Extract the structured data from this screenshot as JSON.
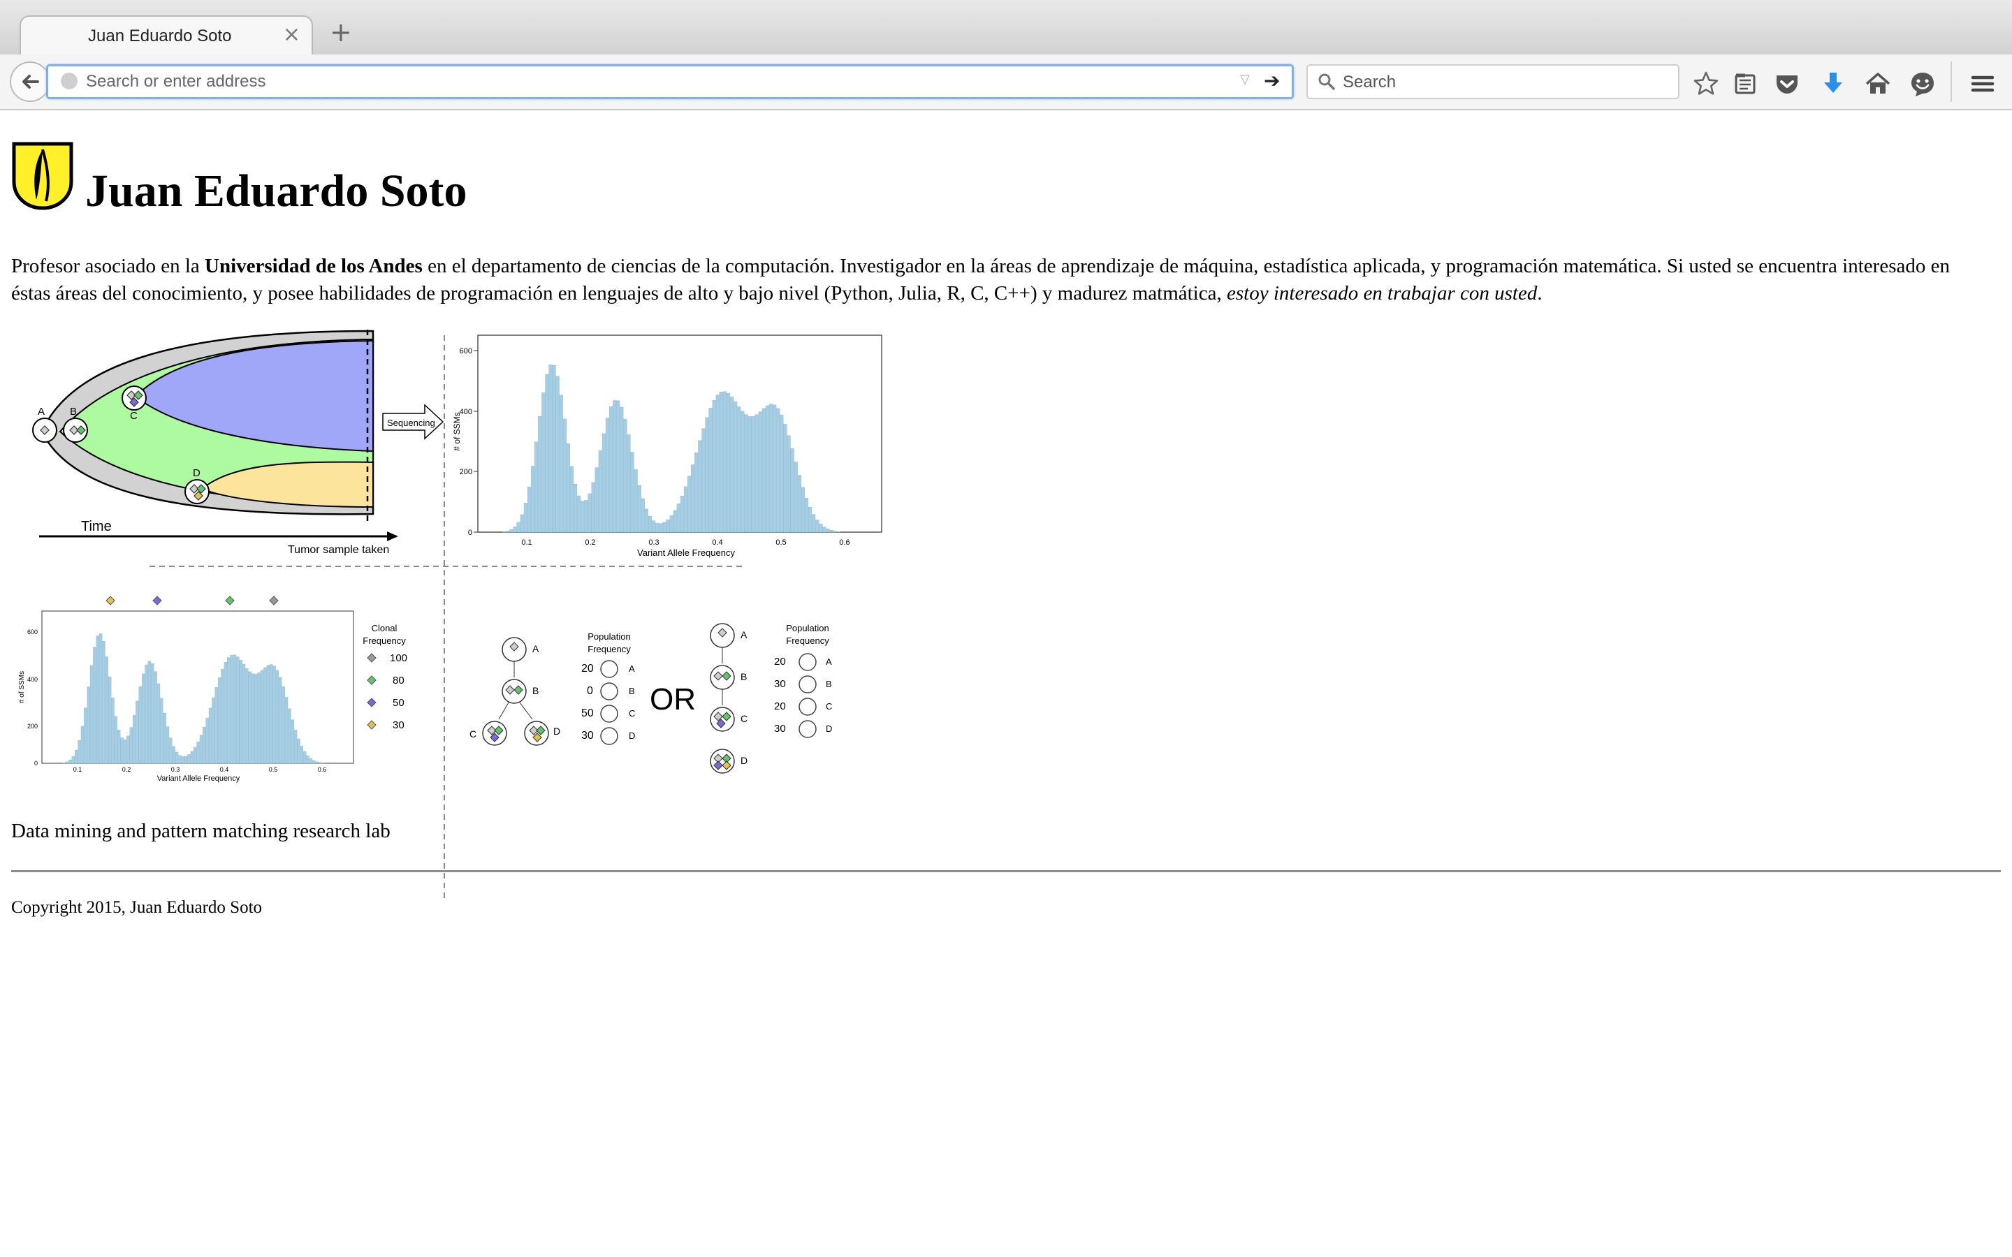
{
  "browser": {
    "tab_title": "Juan Eduardo Soto",
    "tab_close_glyph": "×",
    "new_tab_glyph": "+",
    "address_placeholder": "Search or enter address",
    "address_value": "",
    "search_placeholder": "Search",
    "toolbar_icons": [
      "bookmark-star-icon",
      "reading-list-icon",
      "pocket-icon",
      "downloads-icon",
      "home-icon",
      "hello-icon",
      "menu-icon"
    ],
    "accent_color": "#2a91ea"
  },
  "page": {
    "title": "Juan Eduardo Soto",
    "intro": {
      "part1": "Profesor asociado en la ",
      "university": "Universidad de los Andes",
      "part2": " en el departamento de ciencias de la computación. Investigador en la áreas de aprendizaje de máquina, estadística aplicada, y programación matemática. Si usted se encuentra interesado en éstas áreas del conocimiento, y posee habilidades de programación en lenguajes de alto y bajo nivel (Python, Julia, R, C, C++) y madurez matmática, ",
      "emphasis": "estoy interesado en trabajar con usted",
      "end": "."
    },
    "lab": "Data mining and pattern matching research lab",
    "copyright": "Copyright 2015, Juan Eduardo Soto"
  },
  "figure": {
    "evolution": {
      "clone_labels": [
        "A",
        "B",
        "C",
        "D"
      ],
      "time_label": "Time",
      "sample_label": "Tumor sample taken",
      "arrow_label": "Sequencing",
      "colors": {
        "A": "#cfcfcf",
        "B": "#aefaa0",
        "C": "#a0a6f8",
        "D": "#fde49c"
      }
    },
    "histogram_top": {
      "ylabel": "# of SSMs",
      "xlabel": "Variant Allele Frequency",
      "y_ticks": [
        "600",
        "400",
        "200",
        "0"
      ],
      "x_ticks": [
        "0.1",
        "0.2",
        "0.3",
        "0.4",
        "0.5",
        "0.6"
      ]
    },
    "histogram_bottom": {
      "ylabel": "# of SSMs",
      "xlabel": "Variant Allele Frequency",
      "y_ticks": [
        "600",
        "400",
        "200",
        "0"
      ],
      "x_ticks": [
        "0.1",
        "0.2",
        "0.3",
        "0.4",
        "0.5",
        "0.6"
      ]
    },
    "legend": {
      "title_line1": "Clonal",
      "title_line2": "Frequency",
      "values": [
        "100",
        "80",
        "50",
        "30"
      ],
      "colors": [
        "#9a9a9a",
        "#62c46c",
        "#7a6ad9",
        "#e0c24e"
      ]
    },
    "tree_left": {
      "header_line1": "Population",
      "header_line2": "Frequency",
      "nodes": [
        "A",
        "B",
        "C",
        "D"
      ],
      "frequencies": [
        "20",
        "0",
        "50",
        "30"
      ]
    },
    "or_label": "OR",
    "tree_right": {
      "header_line1": "Population",
      "header_line2": "Frequency",
      "nodes": [
        "A",
        "B",
        "C",
        "D"
      ],
      "frequencies": [
        "20",
        "30",
        "20",
        "30"
      ]
    }
  }
}
